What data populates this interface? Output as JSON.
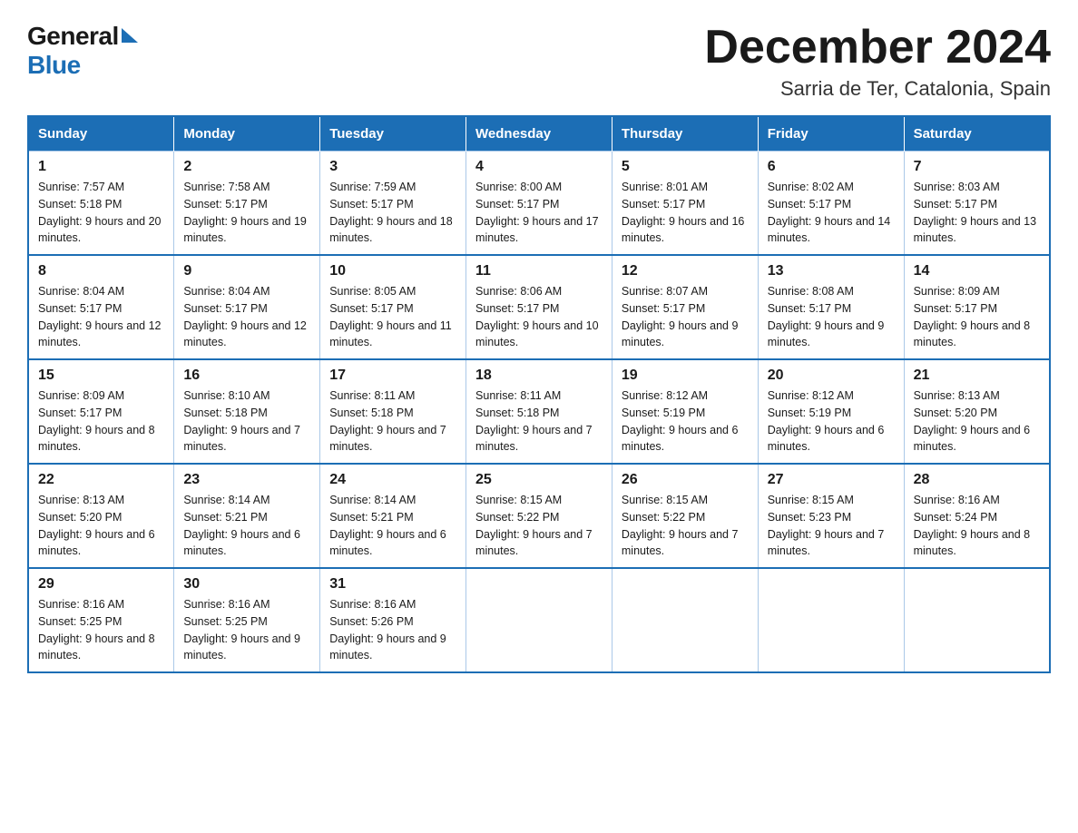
{
  "header": {
    "title": "December 2024",
    "subtitle": "Sarria de Ter, Catalonia, Spain",
    "logo_general": "General",
    "logo_blue": "Blue"
  },
  "columns": [
    "Sunday",
    "Monday",
    "Tuesday",
    "Wednesday",
    "Thursday",
    "Friday",
    "Saturday"
  ],
  "weeks": [
    [
      {
        "day": "1",
        "sunrise": "Sunrise: 7:57 AM",
        "sunset": "Sunset: 5:18 PM",
        "daylight": "Daylight: 9 hours and 20 minutes."
      },
      {
        "day": "2",
        "sunrise": "Sunrise: 7:58 AM",
        "sunset": "Sunset: 5:17 PM",
        "daylight": "Daylight: 9 hours and 19 minutes."
      },
      {
        "day": "3",
        "sunrise": "Sunrise: 7:59 AM",
        "sunset": "Sunset: 5:17 PM",
        "daylight": "Daylight: 9 hours and 18 minutes."
      },
      {
        "day": "4",
        "sunrise": "Sunrise: 8:00 AM",
        "sunset": "Sunset: 5:17 PM",
        "daylight": "Daylight: 9 hours and 17 minutes."
      },
      {
        "day": "5",
        "sunrise": "Sunrise: 8:01 AM",
        "sunset": "Sunset: 5:17 PM",
        "daylight": "Daylight: 9 hours and 16 minutes."
      },
      {
        "day": "6",
        "sunrise": "Sunrise: 8:02 AM",
        "sunset": "Sunset: 5:17 PM",
        "daylight": "Daylight: 9 hours and 14 minutes."
      },
      {
        "day": "7",
        "sunrise": "Sunrise: 8:03 AM",
        "sunset": "Sunset: 5:17 PM",
        "daylight": "Daylight: 9 hours and 13 minutes."
      }
    ],
    [
      {
        "day": "8",
        "sunrise": "Sunrise: 8:04 AM",
        "sunset": "Sunset: 5:17 PM",
        "daylight": "Daylight: 9 hours and 12 minutes."
      },
      {
        "day": "9",
        "sunrise": "Sunrise: 8:04 AM",
        "sunset": "Sunset: 5:17 PM",
        "daylight": "Daylight: 9 hours and 12 minutes."
      },
      {
        "day": "10",
        "sunrise": "Sunrise: 8:05 AM",
        "sunset": "Sunset: 5:17 PM",
        "daylight": "Daylight: 9 hours and 11 minutes."
      },
      {
        "day": "11",
        "sunrise": "Sunrise: 8:06 AM",
        "sunset": "Sunset: 5:17 PM",
        "daylight": "Daylight: 9 hours and 10 minutes."
      },
      {
        "day": "12",
        "sunrise": "Sunrise: 8:07 AM",
        "sunset": "Sunset: 5:17 PM",
        "daylight": "Daylight: 9 hours and 9 minutes."
      },
      {
        "day": "13",
        "sunrise": "Sunrise: 8:08 AM",
        "sunset": "Sunset: 5:17 PM",
        "daylight": "Daylight: 9 hours and 9 minutes."
      },
      {
        "day": "14",
        "sunrise": "Sunrise: 8:09 AM",
        "sunset": "Sunset: 5:17 PM",
        "daylight": "Daylight: 9 hours and 8 minutes."
      }
    ],
    [
      {
        "day": "15",
        "sunrise": "Sunrise: 8:09 AM",
        "sunset": "Sunset: 5:17 PM",
        "daylight": "Daylight: 9 hours and 8 minutes."
      },
      {
        "day": "16",
        "sunrise": "Sunrise: 8:10 AM",
        "sunset": "Sunset: 5:18 PM",
        "daylight": "Daylight: 9 hours and 7 minutes."
      },
      {
        "day": "17",
        "sunrise": "Sunrise: 8:11 AM",
        "sunset": "Sunset: 5:18 PM",
        "daylight": "Daylight: 9 hours and 7 minutes."
      },
      {
        "day": "18",
        "sunrise": "Sunrise: 8:11 AM",
        "sunset": "Sunset: 5:18 PM",
        "daylight": "Daylight: 9 hours and 7 minutes."
      },
      {
        "day": "19",
        "sunrise": "Sunrise: 8:12 AM",
        "sunset": "Sunset: 5:19 PM",
        "daylight": "Daylight: 9 hours and 6 minutes."
      },
      {
        "day": "20",
        "sunrise": "Sunrise: 8:12 AM",
        "sunset": "Sunset: 5:19 PM",
        "daylight": "Daylight: 9 hours and 6 minutes."
      },
      {
        "day": "21",
        "sunrise": "Sunrise: 8:13 AM",
        "sunset": "Sunset: 5:20 PM",
        "daylight": "Daylight: 9 hours and 6 minutes."
      }
    ],
    [
      {
        "day": "22",
        "sunrise": "Sunrise: 8:13 AM",
        "sunset": "Sunset: 5:20 PM",
        "daylight": "Daylight: 9 hours and 6 minutes."
      },
      {
        "day": "23",
        "sunrise": "Sunrise: 8:14 AM",
        "sunset": "Sunset: 5:21 PM",
        "daylight": "Daylight: 9 hours and 6 minutes."
      },
      {
        "day": "24",
        "sunrise": "Sunrise: 8:14 AM",
        "sunset": "Sunset: 5:21 PM",
        "daylight": "Daylight: 9 hours and 6 minutes."
      },
      {
        "day": "25",
        "sunrise": "Sunrise: 8:15 AM",
        "sunset": "Sunset: 5:22 PM",
        "daylight": "Daylight: 9 hours and 7 minutes."
      },
      {
        "day": "26",
        "sunrise": "Sunrise: 8:15 AM",
        "sunset": "Sunset: 5:22 PM",
        "daylight": "Daylight: 9 hours and 7 minutes."
      },
      {
        "day": "27",
        "sunrise": "Sunrise: 8:15 AM",
        "sunset": "Sunset: 5:23 PM",
        "daylight": "Daylight: 9 hours and 7 minutes."
      },
      {
        "day": "28",
        "sunrise": "Sunrise: 8:16 AM",
        "sunset": "Sunset: 5:24 PM",
        "daylight": "Daylight: 9 hours and 8 minutes."
      }
    ],
    [
      {
        "day": "29",
        "sunrise": "Sunrise: 8:16 AM",
        "sunset": "Sunset: 5:25 PM",
        "daylight": "Daylight: 9 hours and 8 minutes."
      },
      {
        "day": "30",
        "sunrise": "Sunrise: 8:16 AM",
        "sunset": "Sunset: 5:25 PM",
        "daylight": "Daylight: 9 hours and 9 minutes."
      },
      {
        "day": "31",
        "sunrise": "Sunrise: 8:16 AM",
        "sunset": "Sunset: 5:26 PM",
        "daylight": "Daylight: 9 hours and 9 minutes."
      },
      null,
      null,
      null,
      null
    ]
  ]
}
